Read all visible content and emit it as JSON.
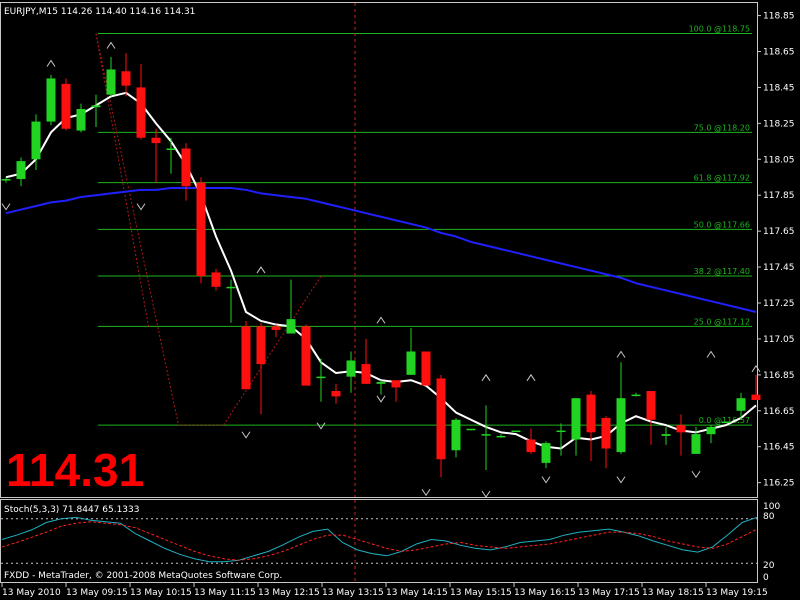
{
  "window": {
    "header": "EURJPY,M15   114.26  114.40  114.16  114.31",
    "current_price": "114.31",
    "footer": "FXDD - MetaTrader, © 2001-2008 MetaQuotes Software Corp."
  },
  "colors": {
    "background": "#000000",
    "bull": "#22d422",
    "bear": "#ff1010",
    "fib": "#1db41d",
    "ma_fast": "#ffffff",
    "ma_slow": "#2020ff",
    "stoch_main": "#20b0c0",
    "stoch_signal": "#ff2020",
    "accent_text": "#ff0000"
  },
  "chart_data": [
    {
      "type": "candlestick",
      "symbol": "EURJPY",
      "timeframe": "M15",
      "ylim": [
        116.17,
        118.92
      ],
      "y_ticks": [
        118.85,
        118.65,
        118.45,
        118.25,
        118.05,
        117.85,
        117.65,
        117.45,
        117.25,
        117.05,
        116.85,
        116.65,
        116.45,
        116.25
      ],
      "y_tick_labels": [
        "118.85",
        "118.65",
        "118.45",
        "118.25",
        "118.05",
        "117.85",
        "117.65",
        "117.45",
        "117.25",
        "117.05",
        "116.85",
        "116.65",
        "116.45",
        "116.25"
      ],
      "x_tick_labels": [
        "13 May 2010",
        "13 May 09:15",
        "13 May 10:15",
        "13 May 11:15",
        "13 May 12:15",
        "13 May 13:15",
        "13 May 14:15",
        "13 May 15:15",
        "13 May 16:15",
        "13 May 17:15",
        "13 May 18:15",
        "13 May 19:15"
      ],
      "candles": [
        [
          117.94,
          117.94,
          117.92,
          117.95
        ],
        [
          117.94,
          118.04,
          117.9,
          118.06
        ],
        [
          118.05,
          118.26,
          117.99,
          118.3
        ],
        [
          118.26,
          118.5,
          118.24,
          118.52
        ],
        [
          118.47,
          118.22,
          118.21,
          118.5
        ],
        [
          118.21,
          118.33,
          118.2,
          118.36
        ],
        [
          118.34,
          118.35,
          118.23,
          118.41
        ],
        [
          118.41,
          118.55,
          118.4,
          118.62
        ],
        [
          118.54,
          118.46,
          118.4,
          118.64
        ],
        [
          118.45,
          118.17,
          118.16,
          118.58
        ],
        [
          118.17,
          118.14,
          117.92,
          118.22
        ],
        [
          118.11,
          118.11,
          117.97,
          118.17
        ],
        [
          118.11,
          117.9,
          117.82,
          118.14
        ],
        [
          117.92,
          117.4,
          117.36,
          117.95
        ],
        [
          117.42,
          117.34,
          117.32,
          117.44
        ],
        [
          117.34,
          117.34,
          117.14,
          117.38
        ],
        [
          117.12,
          116.77,
          116.82,
          117.15
        ],
        [
          117.12,
          116.91,
          116.63,
          117.14
        ],
        [
          117.12,
          117.1,
          117.06,
          117.13
        ],
        [
          117.08,
          117.16,
          117.12,
          117.38
        ],
        [
          117.12,
          116.79,
          116.8,
          117.13
        ],
        [
          116.84,
          116.84,
          116.7,
          116.94
        ],
        [
          116.76,
          116.73,
          116.69,
          116.8
        ],
        [
          116.84,
          116.93,
          116.75,
          116.98
        ],
        [
          116.91,
          116.8,
          116.8,
          117.05
        ],
        [
          116.8,
          116.81,
          116.74,
          116.82
        ],
        [
          116.82,
          116.78,
          116.7,
          116.82
        ],
        [
          116.85,
          116.98,
          116.85,
          117.11
        ],
        [
          116.98,
          116.79,
          116.81,
          116.98
        ],
        [
          116.83,
          116.38,
          116.28,
          116.85
        ],
        [
          116.43,
          116.6,
          116.39,
          116.61
        ],
        [
          116.55,
          116.55,
          116.54,
          116.55
        ],
        [
          116.52,
          116.52,
          116.32,
          116.68
        ],
        [
          116.51,
          116.51,
          116.5,
          116.52
        ],
        [
          116.54,
          116.54,
          116.54,
          116.54
        ],
        [
          116.49,
          116.42,
          116.41,
          116.55
        ],
        [
          116.36,
          116.47,
          116.33,
          116.48
        ],
        [
          116.54,
          116.54,
          116.4,
          116.58
        ],
        [
          116.49,
          116.72,
          116.4,
          116.72
        ],
        [
          116.74,
          116.53,
          116.37,
          116.76
        ],
        [
          116.61,
          116.44,
          116.33,
          116.62
        ],
        [
          116.42,
          116.72,
          116.41,
          116.92
        ],
        [
          116.74,
          116.74,
          116.75,
          116.73
        ],
        [
          116.76,
          116.6,
          116.46,
          116.76
        ],
        [
          116.51,
          116.52,
          116.46,
          116.56
        ],
        [
          116.57,
          116.53,
          116.4,
          116.63
        ],
        [
          116.41,
          116.52,
          116.41,
          116.56
        ],
        [
          116.52,
          116.56,
          116.47,
          116.57
        ],
        [
          116.59,
          116.59,
          116.59,
          116.59
        ],
        [
          116.65,
          116.72,
          116.6,
          116.75
        ],
        [
          116.74,
          116.71,
          116.72,
          116.85
        ]
      ],
      "ma_fast": [
        117.95,
        117.97,
        118.05,
        118.2,
        118.28,
        118.3,
        118.35,
        118.4,
        118.42,
        118.36,
        118.25,
        118.15,
        118.02,
        117.85,
        117.62,
        117.43,
        117.2,
        117.15,
        117.13,
        117.12,
        117.05,
        116.92,
        116.86,
        116.87,
        116.86,
        116.82,
        116.81,
        116.82,
        116.79,
        116.72,
        116.64,
        116.6,
        116.56,
        116.53,
        116.52,
        116.48,
        116.45,
        116.44,
        116.5,
        116.49,
        116.51,
        116.58,
        116.62,
        116.59,
        116.57,
        116.54,
        116.53,
        116.55,
        116.57,
        116.61,
        116.68
      ],
      "ma_slow": [
        117.75,
        117.77,
        117.79,
        117.81,
        117.82,
        117.84,
        117.85,
        117.86,
        117.87,
        117.88,
        117.88,
        117.89,
        117.89,
        117.89,
        117.89,
        117.89,
        117.88,
        117.86,
        117.85,
        117.84,
        117.83,
        117.81,
        117.79,
        117.77,
        117.75,
        117.73,
        117.71,
        117.69,
        117.67,
        117.64,
        117.62,
        117.59,
        117.57,
        117.55,
        117.53,
        117.51,
        117.49,
        117.47,
        117.45,
        117.43,
        117.41,
        117.39,
        117.36,
        117.34,
        117.32,
        117.3,
        117.28,
        117.26,
        117.24,
        117.22,
        117.2
      ],
      "fibonacci": {
        "levels": [
          {
            "pct": 100.0,
            "price": 118.75,
            "label": "100.0 @118.75"
          },
          {
            "pct": 75.0,
            "price": 118.2,
            "label": "75.0 @118.20"
          },
          {
            "pct": 61.8,
            "price": 117.92,
            "label": "61.8 @117.92"
          },
          {
            "pct": 50.0,
            "price": 117.66,
            "label": "50.0 @117.66"
          },
          {
            "pct": 38.2,
            "price": 117.4,
            "label": "38.2 @117.40"
          },
          {
            "pct": 25.0,
            "price": 117.12,
            "label": "25.0 @117.12"
          },
          {
            "pct": 0.0,
            "price": 116.57,
            "label": "0.0 @116.57"
          }
        ]
      },
      "fractals": {
        "up": [
          [
            3,
            118.55
          ],
          [
            7,
            118.65
          ],
          [
            17,
            117.4
          ],
          [
            25,
            117.12
          ],
          [
            32,
            116.8
          ],
          [
            35,
            116.8
          ],
          [
            41,
            116.93
          ],
          [
            47,
            116.93
          ],
          [
            50,
            116.85
          ]
        ],
        "down": [
          [
            0,
            117.82
          ],
          [
            9,
            117.82
          ],
          [
            16,
            116.55
          ],
          [
            21,
            116.6
          ],
          [
            25,
            116.75
          ],
          [
            28,
            116.23
          ],
          [
            32,
            116.22
          ],
          [
            36,
            116.3
          ],
          [
            41,
            116.3
          ],
          [
            46,
            116.33
          ]
        ]
      }
    },
    {
      "type": "line",
      "title": "Stoch(5,3,3) 71.8447 65.1333",
      "levels": [
        80,
        20
      ],
      "ylim": [
        0,
        100
      ],
      "y_tick_labels": [
        "100",
        "80",
        "20",
        "0"
      ],
      "series": [
        {
          "name": "main",
          "values": [
            52,
            58,
            65,
            75,
            80,
            82,
            78,
            76,
            74,
            60,
            50,
            40,
            32,
            26,
            22,
            22,
            24,
            30,
            36,
            45,
            55,
            63,
            66,
            48,
            38,
            33,
            30,
            36,
            46,
            52,
            50,
            44,
            40,
            38,
            42,
            48,
            50,
            52,
            58,
            62,
            64,
            66,
            62,
            57,
            50,
            44,
            38,
            35,
            42,
            58,
            75,
            82
          ]
        },
        {
          "name": "signal",
          "values": [
            42,
            48,
            55,
            62,
            70,
            74,
            76,
            74,
            72,
            68,
            60,
            52,
            44,
            36,
            30,
            26,
            24,
            26,
            30,
            36,
            44,
            52,
            58,
            58,
            52,
            46,
            40,
            36,
            38,
            42,
            46,
            48,
            44,
            42,
            40,
            42,
            44,
            46,
            50,
            54,
            58,
            62,
            62,
            60,
            56,
            50,
            46,
            42,
            40,
            46,
            56,
            66
          ]
        }
      ]
    }
  ]
}
